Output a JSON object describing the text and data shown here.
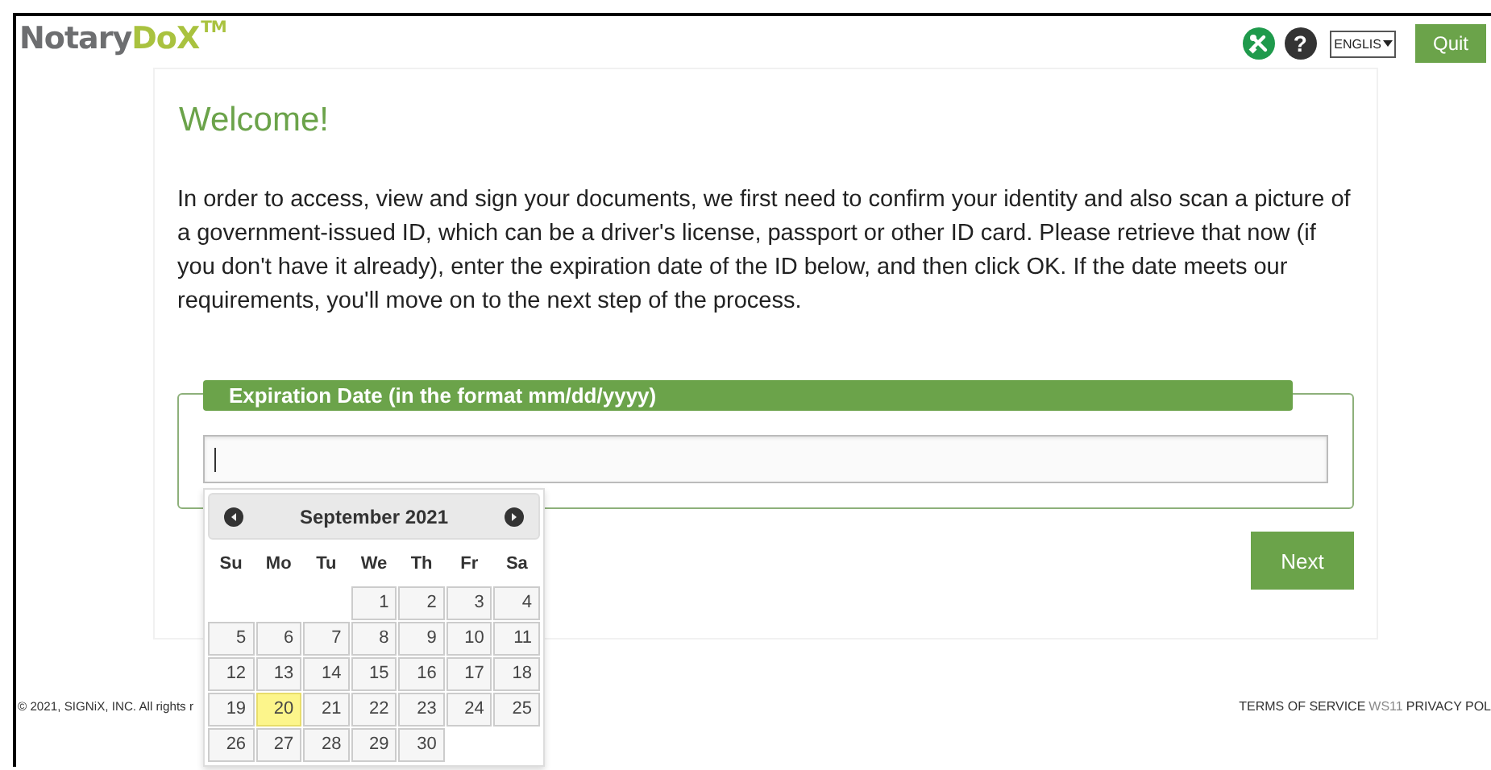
{
  "header": {
    "logo": {
      "part_1": "Notary",
      "part_2": "DoX",
      "mark": "TM"
    },
    "help_label": "?",
    "language": "ENGLIS",
    "quit_label": "Quit"
  },
  "welcome": {
    "title": "Welcome!",
    "text": "In order to access, view and sign your documents, we first need to confirm your identity and also scan a picture of a government-issued ID, which can be a driver's license, passport or other ID card. Please retrieve that now (if you don't have it already), enter the expiration date of the ID below, and then click OK. If the date meets our requirements, you'll move on to the next step of the process."
  },
  "expiration_field": {
    "legend": "Expiration Date (in the format mm/dd/yyyy)"
  },
  "datepicker": {
    "month": "September 2021",
    "weekdays": [
      "Su",
      "Mo",
      "Tu",
      "We",
      "Th",
      "Fr",
      "Sa"
    ],
    "weeks": [
      [
        {
          "kind": "empty"
        },
        {
          "kind": "empty"
        },
        {
          "kind": "empty"
        },
        {
          "kind": "day",
          "label": "1",
          "selected": false
        },
        {
          "kind": "day",
          "label": "2",
          "selected": false
        },
        {
          "kind": "day",
          "label": "3",
          "selected": false
        },
        {
          "kind": "day",
          "label": "4",
          "selected": false
        }
      ],
      [
        {
          "kind": "day",
          "label": "5",
          "selected": false
        },
        {
          "kind": "day",
          "label": "6",
          "selected": false
        },
        {
          "kind": "day",
          "label": "7",
          "selected": false
        },
        {
          "kind": "day",
          "label": "8",
          "selected": false
        },
        {
          "kind": "day",
          "label": "9",
          "selected": false
        },
        {
          "kind": "day",
          "label": "10",
          "selected": false
        },
        {
          "kind": "day",
          "label": "11",
          "selected": false
        }
      ],
      [
        {
          "kind": "day",
          "label": "12",
          "selected": false
        },
        {
          "kind": "day",
          "label": "13",
          "selected": false
        },
        {
          "kind": "day",
          "label": "14",
          "selected": false
        },
        {
          "kind": "day",
          "label": "15",
          "selected": false
        },
        {
          "kind": "day",
          "label": "16",
          "selected": false
        },
        {
          "kind": "day",
          "label": "17",
          "selected": false
        },
        {
          "kind": "day",
          "label": "18",
          "selected": false
        }
      ],
      [
        {
          "kind": "day",
          "label": "19",
          "selected": false
        },
        {
          "kind": "day",
          "label": "20",
          "selected": true
        },
        {
          "kind": "day",
          "label": "21",
          "selected": false
        },
        {
          "kind": "day",
          "label": "22",
          "selected": false
        },
        {
          "kind": "day",
          "label": "23",
          "selected": false
        },
        {
          "kind": "day",
          "label": "24",
          "selected": false
        },
        {
          "kind": "day",
          "label": "25",
          "selected": false
        }
      ],
      [
        {
          "kind": "day",
          "label": "26",
          "selected": false
        },
        {
          "kind": "day",
          "label": "27",
          "selected": false
        },
        {
          "kind": "day",
          "label": "28",
          "selected": false
        },
        {
          "kind": "day",
          "label": "29",
          "selected": false
        },
        {
          "kind": "day",
          "label": "30",
          "selected": false
        },
        {
          "kind": "empty"
        },
        {
          "kind": "empty"
        }
      ]
    ]
  },
  "next_label": "Next",
  "footer": {
    "copyright": "© 2021, SIGNiX, INC. All rights r",
    "terms": "TERMS OF SERVICE",
    "version": "WS11",
    "privacy": "PRIVACY POL"
  }
}
